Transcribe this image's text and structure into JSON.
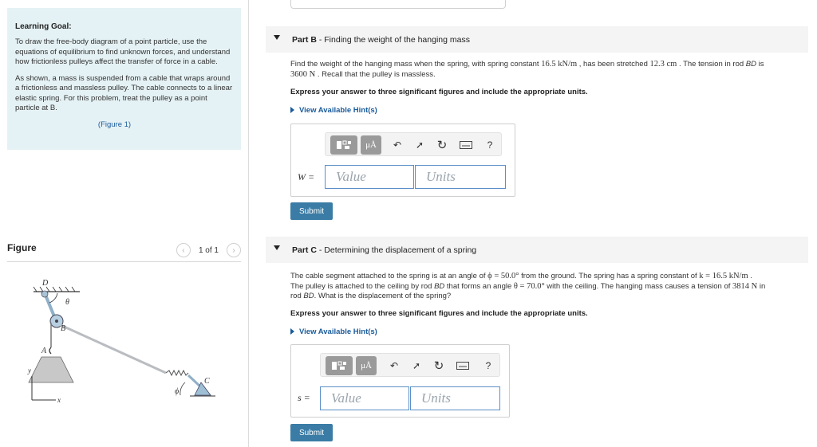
{
  "learning_goal": {
    "title": "Learning Goal:",
    "p1": "To draw the free-body diagram of a point particle, use the equations of equilibrium to find unknown forces, and understand how frictionless pulleys affect the transfer of force in a cable.",
    "p2": "As shown, a mass is suspended from a cable that wraps around a frictionless and massless pulley. The cable connects to a linear elastic spring. For this problem, treat the pulley as a point particle at B.",
    "figure_link": "(Figure 1)"
  },
  "figure": {
    "title": "Figure",
    "pager": "1 of 1",
    "labels": {
      "D": "D",
      "theta": "θ",
      "B": "B",
      "A": "A",
      "C": "C",
      "phi": "ϕ",
      "y": "y",
      "x": "x"
    }
  },
  "part_b": {
    "title_bold": "Part B",
    "title_rest": " - Finding the weight of the hanging mass",
    "line1_a": "Find the weight of the hanging mass when the spring, with spring constant ",
    "k_value": "16.5 kN/m",
    "line1_b": " , has been stretched ",
    "stretch": "12.3 cm",
    "line1_c": " . The tension in rod ",
    "rod": "BD",
    "line1_d": " is",
    "tension": "3600 N",
    "line2": " . Recall that the pulley is massless.",
    "express": "Express your answer to three significant figures and include the appropriate units.",
    "hint": "View Available Hint(s)",
    "var": "W =",
    "value_placeholder": "Value",
    "units_placeholder": "Units",
    "submit": "Submit"
  },
  "part_c": {
    "title_bold": "Part C",
    "title_rest": " - Determining the displacement of a spring",
    "line1_a": "The cable segment attached to the spring is at an angle of ",
    "phi_eq": "ϕ = 50.0°",
    "line1_b": " from the ground. The spring has a spring constant of ",
    "k_eq": "k = 16.5 kN/m",
    "line1_c": " .",
    "line2_a": "The pulley is attached to the ceiling by rod ",
    "rod": "BD",
    "line2_b": " that forms an angle ",
    "theta_eq": "θ = 70.0°",
    "line2_c": " with the ceiling. The hanging mass causes a tension of ",
    "tension": "3814 N",
    "line2_d": " in",
    "line3_a": "rod ",
    "line3_b": ". What is the displacement of the spring?",
    "express": "Express your answer to three significant figures and include the appropriate units.",
    "hint": "View Available Hint(s)",
    "var": "s =",
    "value_placeholder": "Value",
    "units_placeholder": "Units",
    "submit": "Submit"
  },
  "toolbar": {
    "mu_label": "μÅ",
    "help": "?"
  }
}
